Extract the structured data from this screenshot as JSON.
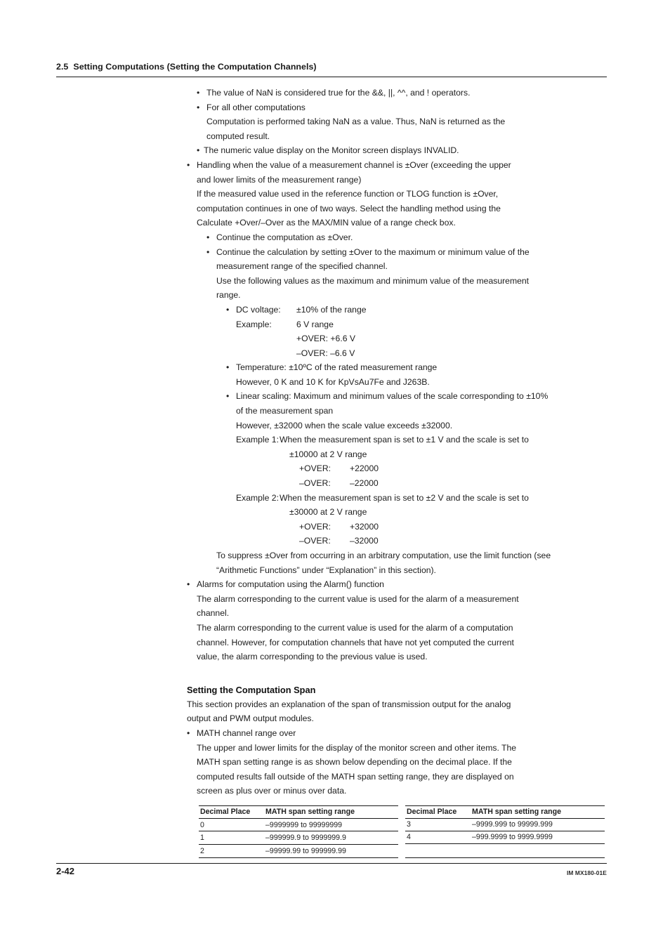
{
  "running_head": {
    "section_number": "2.5",
    "title": "Setting Computations (Setting the Computation Channels)"
  },
  "body": {
    "nan_bullets": {
      "b1": "The value of NaN is considered true for the &&, ||, ^^, and ! operators.",
      "b2_head": "For all other computations",
      "b2_line1": "Computation is performed taking NaN as a value. Thus, NaN is returned as the",
      "b2_line2": "computed result.",
      "b3": "The numeric value display on the Monitor screen displays INVALID."
    },
    "over_handling": {
      "head_line1": "Handling when the value of a measurement channel is ±Over (exceeding the upper",
      "head_line2": "and lower limits of the measurement range)",
      "para_line1": "If the measured value used in the reference function or TLOG function is ±Over,",
      "para_line2": "computation continues in one of two ways. Select the handling method using the",
      "para_line3": "Calculate +Over/–Over as the MAX/MIN value of a range check box.",
      "opt1": "Continue the computation as ±Over.",
      "opt2_line1": "Continue the calculation by setting ±Over to the maximum or minimum value of the",
      "opt2_line2": "measurement range of the specified channel.",
      "opt2_line3": "Use the following values as the maximum and minimum value of the measurement",
      "opt2_line4": "range."
    },
    "dc_voltage": {
      "label": "DC voltage:",
      "value": "±10% of the range",
      "example_label": "Example:",
      "example_value": "6 V range",
      "plus_over_label": "+OVER: +6.6 V",
      "minus_over_label": "–OVER: –6.6 V"
    },
    "temperature": {
      "line1": "Temperature: ±10ºC of the rated measurement range",
      "line2": "However, 0 K and 10 K for KpVsAu7Fe and J263B."
    },
    "linear_scaling": {
      "line1": "Linear scaling: Maximum and minimum values of the scale corresponding to ±10%",
      "line2": "of the measurement span",
      "line3": "However, ±32000 when the scale value exceeds ±32000.",
      "example1_label": "Example 1:",
      "example1_line1": "When the measurement span is set to ±1 V and the scale is set to",
      "example1_line2": "±10000 at 2 V range",
      "example1_plus_label": "+OVER:",
      "example1_plus_value": "+22000",
      "example1_minus_label": "–OVER:",
      "example1_minus_value": "–22000",
      "example2_label": "Example 2:",
      "example2_line1": "When the measurement span is set to ±2 V and the scale is set to",
      "example2_line2": "±30000 at 2 V range",
      "example2_plus_label": "+OVER:",
      "example2_plus_value": "+32000",
      "example2_minus_label": "–OVER:",
      "example2_minus_value": "–32000"
    },
    "suppress_note": {
      "line1": "To suppress ±Over from occurring in an arbitrary computation, use the limit function (see",
      "line2": "“Arithmetic Functions” under “Explanation” in this section)."
    },
    "alarms": {
      "head": "Alarms for computation using the Alarm() function",
      "p1_line1": "The alarm corresponding to the current value is used for the alarm of a measurement",
      "p1_line2": "channel.",
      "p2_line1": "The alarm corresponding to the current value is used for the alarm of a computation",
      "p2_line2": "channel. However, for computation channels that have not yet computed the current",
      "p2_line3": "value, the alarm corresponding to the previous value is used."
    },
    "computation_span": {
      "heading": "Setting the Computation Span",
      "intro_line1": "This section provides an explanation of the span of transmission output for the analog",
      "intro_line2": "output and PWM output modules.",
      "bullet": "MATH channel range over",
      "body_line1": "The upper and lower limits for the display of the monitor screen and other items. The",
      "body_line2": "MATH span setting range is as shown below depending on the decimal place. If the",
      "body_line3": "computed results fall outside of the MATH span setting range, they are displayed on",
      "body_line4": "screen as plus over or minus over data."
    }
  },
  "tables": {
    "left": {
      "headers": [
        "Decimal Place",
        "MATH span setting range"
      ],
      "rows": [
        [
          "0",
          "–9999999 to 99999999"
        ],
        [
          "1",
          "–999999.9 to 9999999.9"
        ],
        [
          "2",
          "–99999.99 to 999999.99"
        ]
      ]
    },
    "right": {
      "headers": [
        "Decimal Place",
        "MATH span setting range"
      ],
      "rows": [
        [
          "3",
          "–9999.999 to 99999.999"
        ],
        [
          "4",
          "–999.9999 to 9999.9999"
        ]
      ]
    }
  },
  "footer": {
    "page_number": "2-42",
    "document_number": "IM MX180-01E"
  },
  "glyphs": {
    "bullet": "•"
  }
}
